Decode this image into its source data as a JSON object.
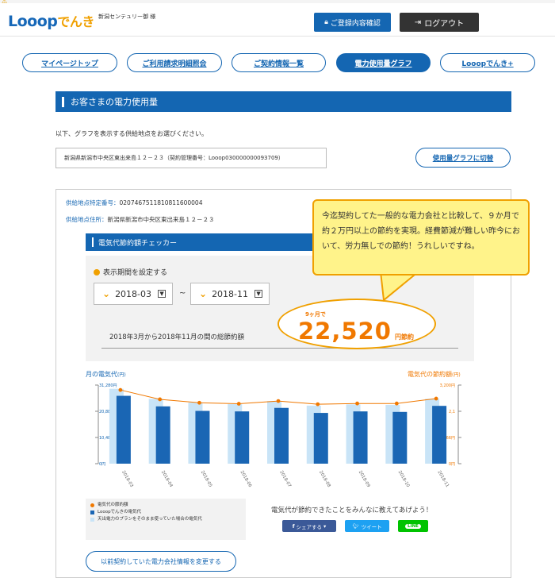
{
  "header": {
    "logo_en": "Looop",
    "logo_jp": "でんき",
    "user_name": "新潟センテュリー御 様",
    "register_button": "ご登録内容確認",
    "logout_button": "ログアウト"
  },
  "nav": [
    {
      "label": "マイページトップ"
    },
    {
      "label": "ご利用請求明細照会"
    },
    {
      "label": "ご契約情報一覧"
    },
    {
      "label": "電力使用量グラフ"
    },
    {
      "label": "Looopでんき+"
    }
  ],
  "section_title": "お客さまの電力使用量",
  "instruction": "以下、グラフを表示する供給地点をお選びください。",
  "address_select": "新潟県新潟市中央区東出来島１２－２３（契約管理番号：Looop030000000093709）",
  "switch_button": "使用量グラフに切替",
  "supply_id_label": "供給地点特定番号：",
  "supply_id": "0207467511810811600004",
  "supply_addr_label": "供給地点住所：",
  "supply_addr": "新潟県新潟市中央区東出来島１２－２３",
  "checker_title": "電気代節約額チェッカー",
  "period_label": "表示期間を設定する",
  "period_from": "2018-03",
  "period_to": "2018-11",
  "period_tilde": "~",
  "total_label": "2018年3月から2018年11月の間の総節約額",
  "months_label": "9ヶ月で",
  "total_amount": "22,520",
  "total_unit": "円節約",
  "bubble_text": "今迄契約してた一般的な電力会社と比較して、９か月で約２万円以上の節約を実現。経費節減が難しい昨今において、労力無しでの節約！うれしいですね。",
  "chart_left_title": "月の電気代",
  "chart_left_unit": "(円)",
  "chart_right_title": "電気代の節約額",
  "chart_right_unit": "(円)",
  "colors": {
    "primary": "#1466b2",
    "accent": "#f07800",
    "light_blue": "#c9e4f7",
    "dark_blue": "#1a66b4"
  },
  "chart_data": {
    "type": "bar",
    "categories": [
      "2018-03",
      "2018-04",
      "2018-05",
      "2018-06",
      "2018-07",
      "2018-08",
      "2018-09",
      "2018-10",
      "2018-11"
    ],
    "left_axis_ticks": [
      "31,280円",
      "20,88",
      "10,48",
      "0円"
    ],
    "right_axis_ticks": [
      "3,200円",
      "2,1",
      "1,066円",
      "0円"
    ],
    "ylim_left": [
      0,
      31280
    ],
    "ylim_right": [
      0,
      3200
    ],
    "series": [
      {
        "name": "天出電力のプランをそのまま使っていた場合の電気代",
        "type": "bar",
        "axis": "left",
        "values": [
          29800,
          25800,
          24300,
          23700,
          24900,
          23100,
          23600,
          23400,
          25800
        ]
      },
      {
        "name": "Looopでんきの電気代",
        "type": "bar",
        "axis": "left",
        "values": [
          27000,
          22800,
          21000,
          20800,
          22200,
          20200,
          20800,
          20600,
          23000
        ]
      },
      {
        "name": "電気代の節約額",
        "type": "line",
        "axis": "right",
        "values": [
          3000,
          2620,
          2480,
          2440,
          2550,
          2420,
          2450,
          2450,
          2650
        ]
      }
    ]
  },
  "legend": [
    {
      "label": "電気代の節約額",
      "color": "#f07800"
    },
    {
      "label": "Looopでんきの電気代",
      "color": "#1a66b4"
    },
    {
      "label": "天出電力のプランをそのまま使っていた場合の電気代",
      "color": "#c9e4f7"
    }
  ],
  "share_text": "電気代が節約できたことをみんなに教えてあげよう！",
  "share_facebook": "シェアする",
  "share_twitter": "ツイート",
  "share_line": "LINE",
  "change_button": "以前契約していた電力会社情報を変更する"
}
